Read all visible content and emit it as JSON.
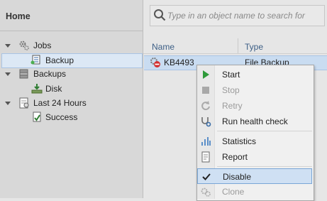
{
  "left_panel": {
    "title": "Home",
    "tree": [
      {
        "label": "Jobs",
        "icon": "gears-icon"
      },
      {
        "label": "Backup",
        "icon": "backup-job-icon"
      },
      {
        "label": "Backups",
        "icon": "backups-icon"
      },
      {
        "label": "Disk",
        "icon": "disk-icon"
      },
      {
        "label": "Last 24 Hours",
        "icon": "last-24-hours-icon"
      },
      {
        "label": "Success",
        "icon": "success-icon"
      }
    ]
  },
  "search": {
    "placeholder": "Type in an object name to search for"
  },
  "table": {
    "columns": [
      "Name",
      "Type"
    ],
    "rows": [
      {
        "name": "KB4493",
        "type": "File Backup"
      }
    ]
  },
  "context_menu": {
    "items": [
      {
        "label": "Start",
        "icon": "play-icon",
        "enabled": true
      },
      {
        "label": "Stop",
        "icon": "stop-icon",
        "enabled": false
      },
      {
        "label": "Retry",
        "icon": "retry-icon",
        "enabled": false
      },
      {
        "label": "Run health check",
        "icon": "stethoscope-icon",
        "enabled": true
      },
      {
        "label": "Statistics",
        "icon": "statistics-icon",
        "enabled": true
      },
      {
        "label": "Report",
        "icon": "report-icon",
        "enabled": true
      },
      {
        "label": "Disable",
        "icon": "checkmark-icon",
        "enabled": true,
        "checked": true
      },
      {
        "label": "Clone",
        "icon": "clone-icon",
        "enabled": false
      }
    ]
  },
  "colors": {
    "accent": "#2e7d32",
    "selection": "#cfe0f3",
    "selection_border": "#7aa6d6"
  }
}
